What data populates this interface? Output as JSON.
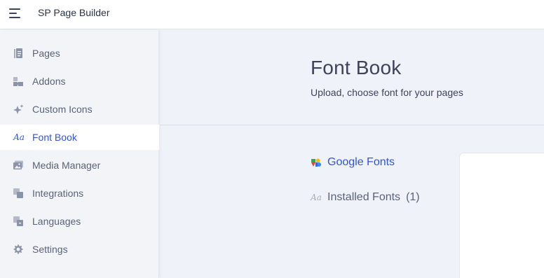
{
  "app": {
    "title": "SP Page Builder"
  },
  "sidebar": {
    "items": [
      {
        "label": "Pages",
        "icon": "pages-icon",
        "active": false
      },
      {
        "label": "Addons",
        "icon": "addons-icon",
        "active": false
      },
      {
        "label": "Custom Icons",
        "icon": "sparkle-icon",
        "active": false
      },
      {
        "label": "Font Book",
        "icon": "font-icon",
        "active": true
      },
      {
        "label": "Media Manager",
        "icon": "media-icon",
        "active": false
      },
      {
        "label": "Integrations",
        "icon": "integrations-icon",
        "active": false
      },
      {
        "label": "Languages",
        "icon": "languages-icon",
        "active": false
      },
      {
        "label": "Settings",
        "icon": "gear-icon",
        "active": false
      }
    ]
  },
  "main": {
    "title": "Font Book",
    "subtitle": "Upload, choose font for your pages",
    "tabs": [
      {
        "label": "Google Fonts",
        "icon": "google-fonts-icon",
        "active": true
      },
      {
        "label": "Installed Fonts",
        "count": "(1)",
        "icon": "font-icon",
        "active": false
      }
    ]
  },
  "colors": {
    "accent": "#3256d4",
    "background": "#eff2f9",
    "sidebar": "#f3f4f7",
    "text": "#3d4459"
  }
}
